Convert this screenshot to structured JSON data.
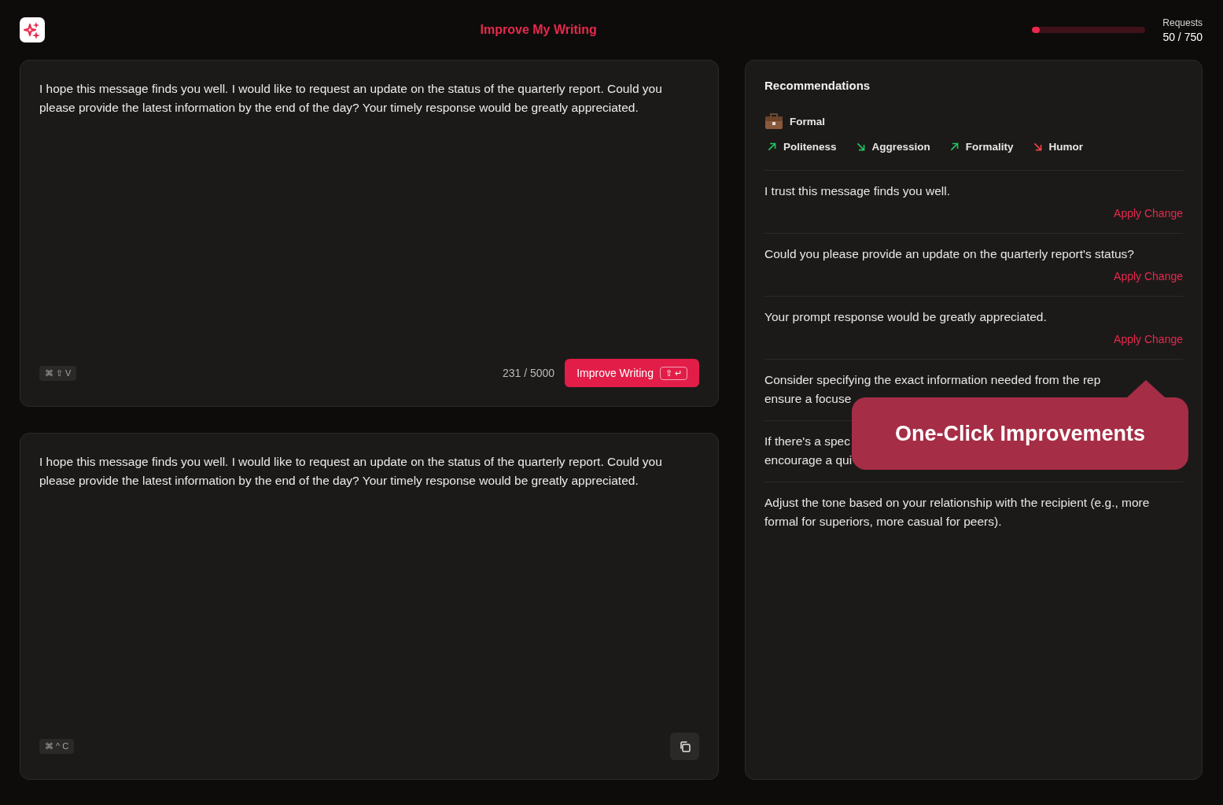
{
  "header": {
    "title": "Improve My Writing",
    "usage": {
      "label": "Requests",
      "count": "50 / 750",
      "level": 0.0667
    }
  },
  "input_panel": {
    "text": "I hope this message finds you well. I would like to request an update on the status of the quarterly report. Could you please provide the latest information by the end of the day? Your timely response would be greatly appreciated.",
    "shortcut": "⌘ ⇧ V",
    "counter": "231 / 5000",
    "button": {
      "label": "Improve Writing",
      "keys": "⇧ ↵"
    }
  },
  "output_panel": {
    "text": "I hope this message finds you well. I would like to request an update on the status of the quarterly report. Could you please provide the latest information by the end of the day? Your timely response would be greatly appreciated.",
    "shortcut": "⌘ ^ C"
  },
  "recommendations": {
    "title": "Recommendations",
    "tone": "Formal",
    "traits": [
      {
        "label": "Politeness",
        "kind": "up",
        "color": "#22c55e"
      },
      {
        "label": "Aggression",
        "kind": "down",
        "color": "#22c55e"
      },
      {
        "label": "Formality",
        "kind": "up",
        "color": "#22c55e"
      },
      {
        "label": "Humor",
        "kind": "down",
        "color": "#ef4444"
      }
    ],
    "items": [
      {
        "kind": "suggestion",
        "text": "I trust this message finds you well.",
        "action": "Apply Change"
      },
      {
        "kind": "suggestion",
        "text": "Could you please provide an update on the quarterly report's status?",
        "action": "Apply Change"
      },
      {
        "kind": "suggestion",
        "text": "Your prompt response would be greatly appreciated.",
        "action": "Apply Change"
      },
      {
        "kind": "tip",
        "lines": [
          "Consider specifying the exact information needed from the rep",
          "ensure a focuse"
        ]
      },
      {
        "kind": "tip",
        "lines": [
          "If there's a spec",
          "encourage a qui"
        ]
      },
      {
        "kind": "tip",
        "lines": [
          "Adjust the tone based on your relationship with the recipient (e.g., more",
          "formal for superiors, more casual for peers)."
        ]
      }
    ]
  },
  "callout": {
    "text": "One-Click Improvements"
  }
}
